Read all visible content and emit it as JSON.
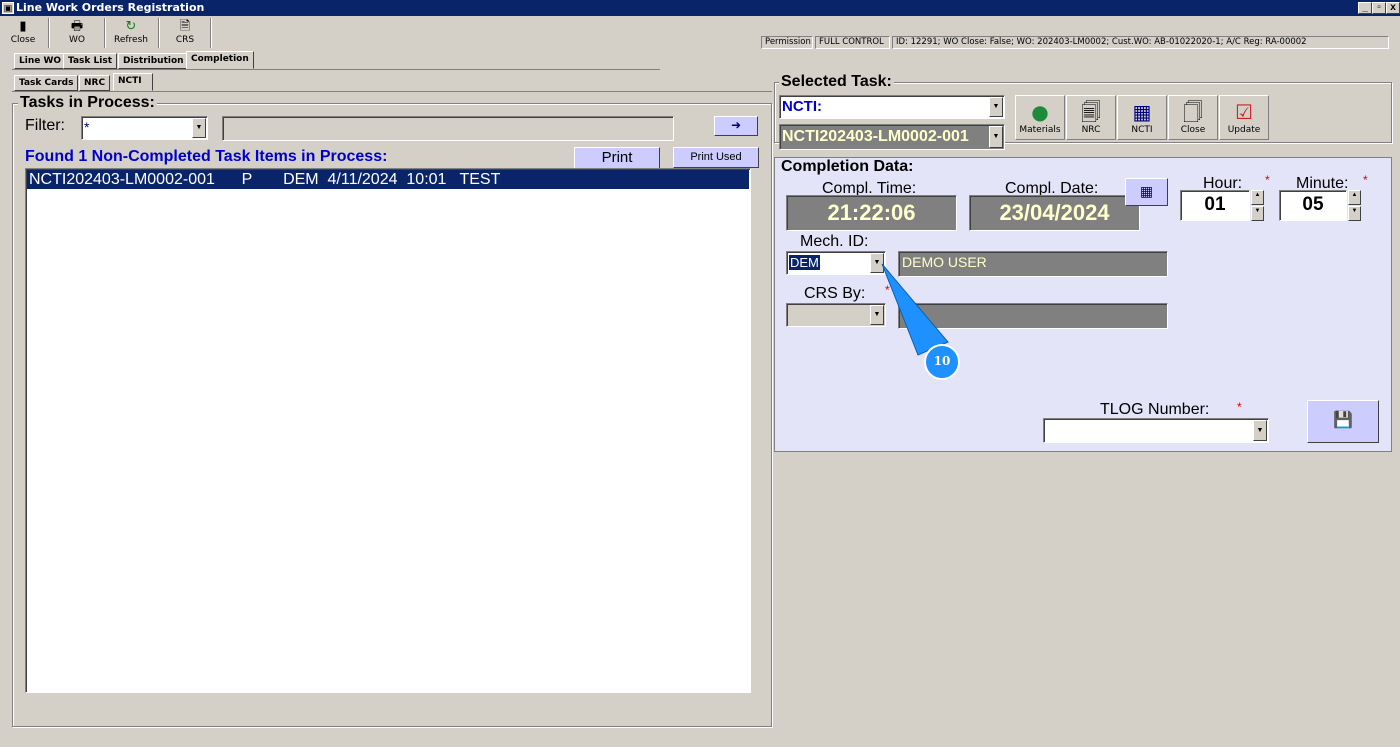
{
  "window": {
    "title": "Line Work Orders Registration",
    "icon": "app-icon",
    "minimize": "_",
    "restore": "▫",
    "close": "x"
  },
  "toolbar": {
    "close_label": "Close",
    "wo_label": "WO",
    "refresh_label": "Refresh",
    "crs_label": "CRS"
  },
  "status": {
    "permission_label": "Permission:",
    "permission_value": "FULL CONTROL",
    "info": "ID: 12291; WO Close: False; WO: 202403-LM0002; Cust.WO: AB-01022020-1; A/C Reg: RA-00002"
  },
  "tabs_top": [
    "Line WO",
    "Task List",
    "Distribution",
    "Completion"
  ],
  "tabs_sub": [
    "Task Cards",
    "NRC",
    "NCTI"
  ],
  "left": {
    "group_title": "Tasks in Process:",
    "filter_label": "Filter:",
    "filter_value": "*",
    "found_text": "Found 1 Non-Completed Task Items in Process:",
    "print_label": "Print",
    "print_used_label": "Print Used",
    "rows": [
      {
        "text": "NCTI202403-LM0002-001      P       DEM  4/11/2024  10:01   TEST"
      }
    ]
  },
  "selected_task": {
    "title": "Selected Task:",
    "type_value": "NCTI:",
    "task_value": "NCTI202403-LM0002-001",
    "buttons": {
      "materials": "Materials",
      "nrc": "NRC",
      "ncti": "NCTI",
      "close": "Close",
      "update": "Update"
    }
  },
  "completion": {
    "title": "Completion Data:",
    "time_label": "Compl. Time:",
    "time_value": "21:22:06",
    "date_label": "Compl. Date:",
    "date_value": "23/04/2024",
    "hour_label": "Hour:",
    "hour_value": "01",
    "minute_label": "Minute:",
    "minute_value": "05",
    "mech_label": "Mech. ID:",
    "mech_value": "DEM",
    "mech_name": "DEMO USER",
    "crs_label": "CRS By:",
    "crs_value": "",
    "crs_name": "",
    "tlog_label": "TLOG Number:",
    "tlog_value": "",
    "required_mark": "*"
  },
  "callout": {
    "number": "10",
    "color": "#1e90ff"
  }
}
